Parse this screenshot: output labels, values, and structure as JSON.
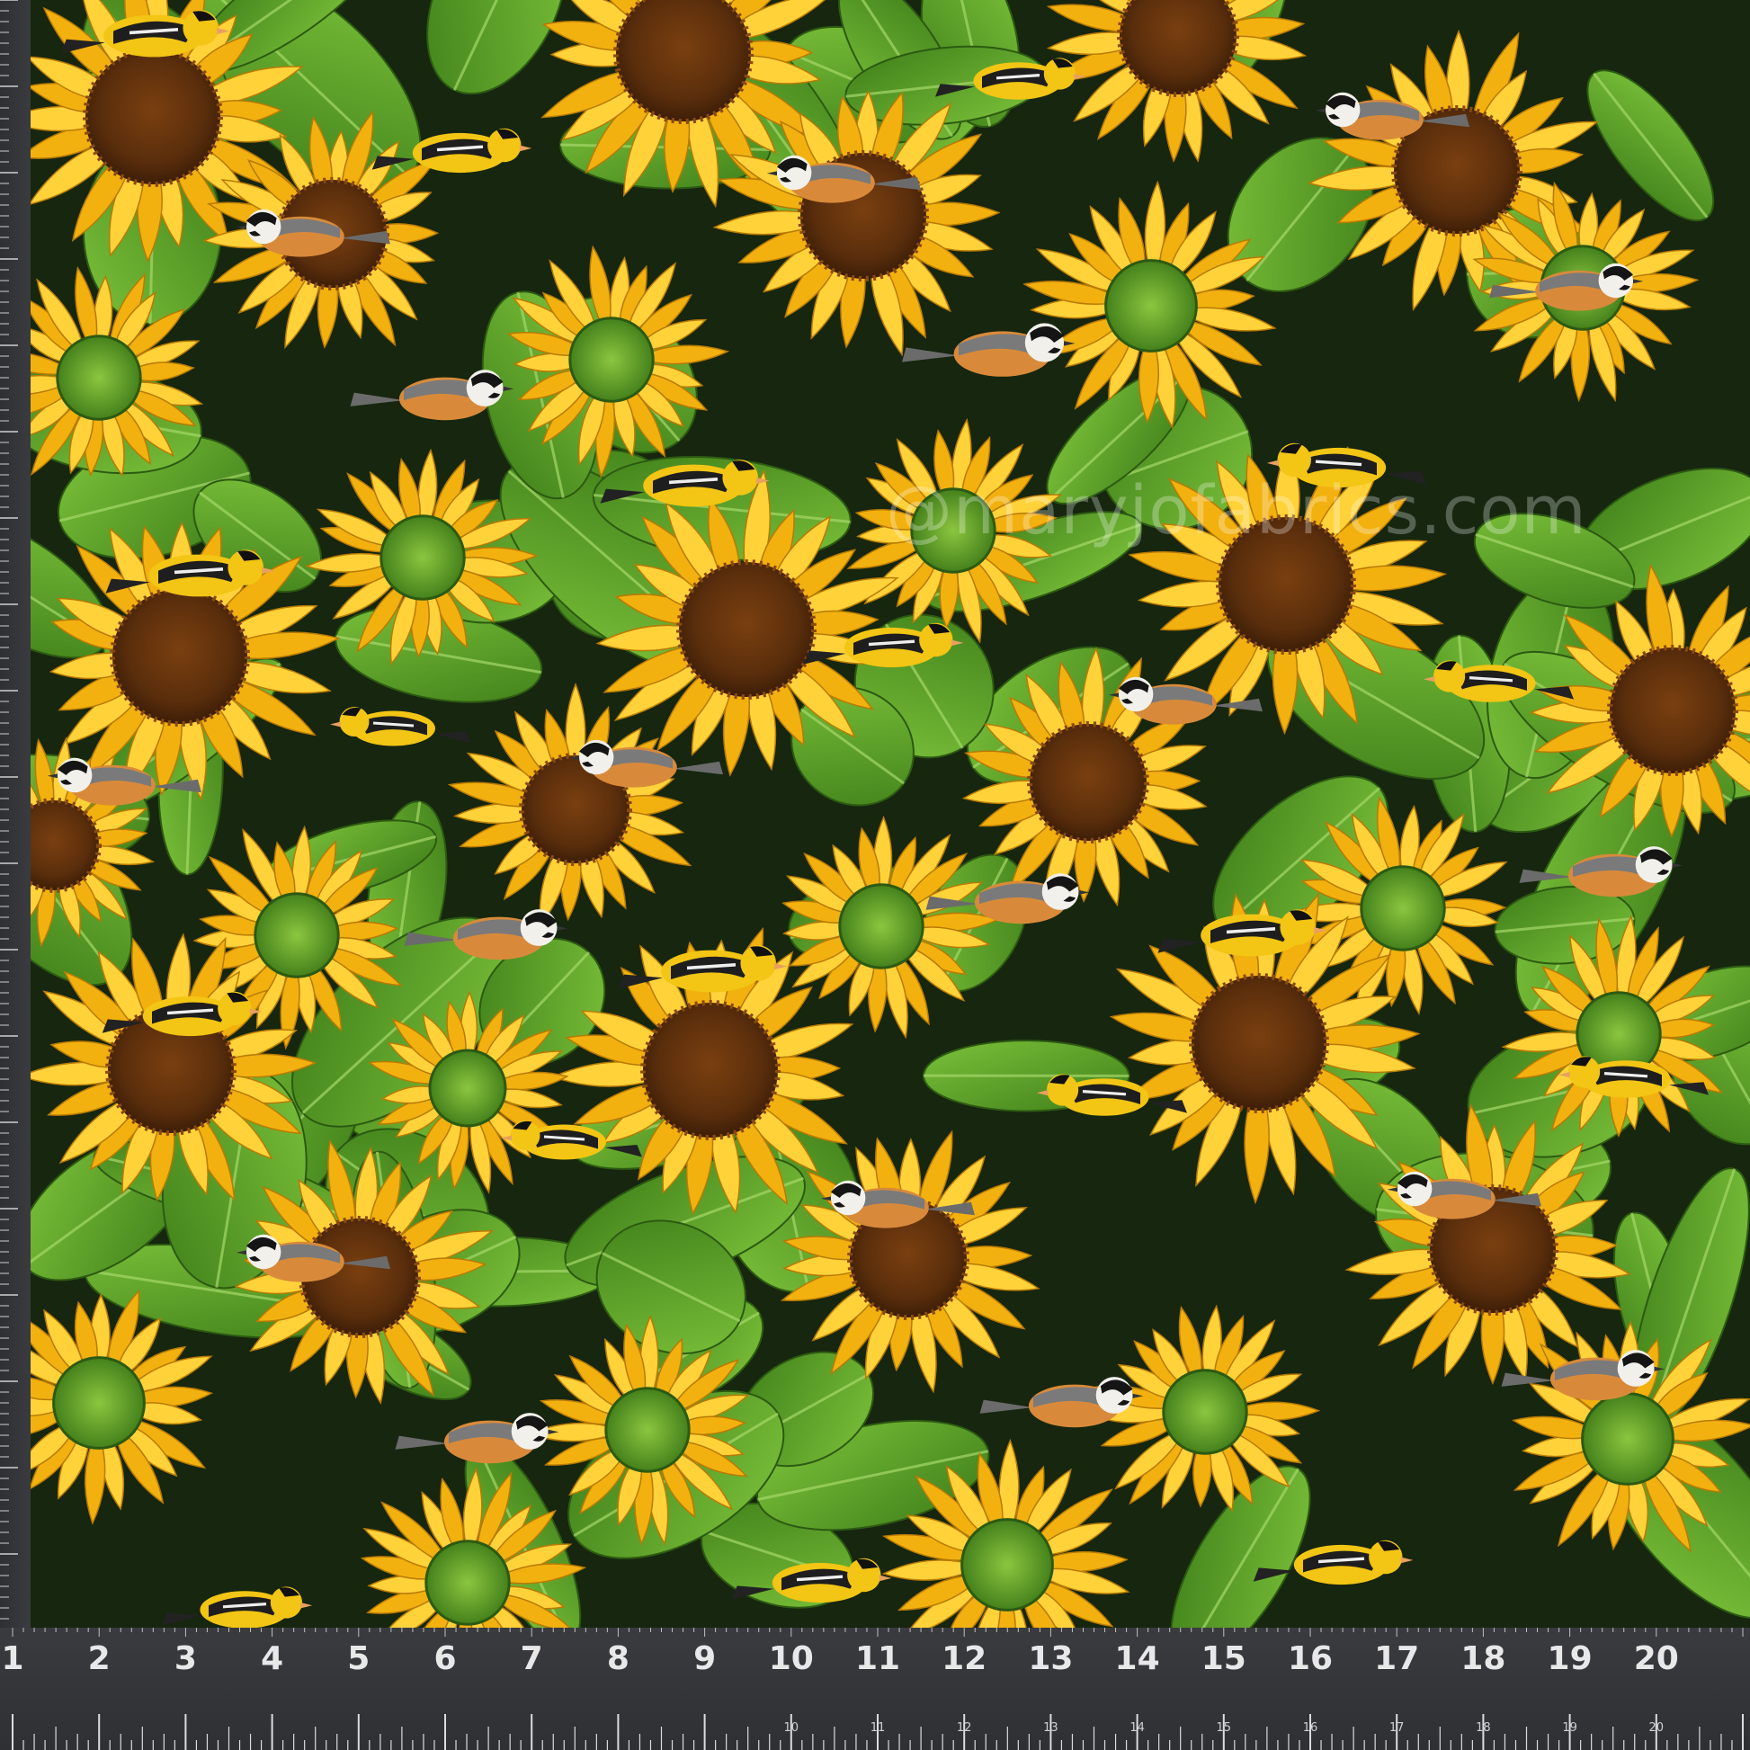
{
  "image": {
    "subject": "sunflower and songbird print cotton fabric on a cutting mat",
    "colors": {
      "background": "#16260f",
      "petal": "#f2b10f",
      "petal_light": "#ffd23a",
      "center": "#5a2e0c",
      "leaf": "#4f9a22",
      "leaf_light": "#7cc23a",
      "goldfinch": "#f3c514",
      "chickadee_breast": "#d88a3a",
      "mat": "#35363a"
    }
  },
  "watermark": {
    "text": "@maryjofabrics.com"
  },
  "ruler": {
    "major_labels": [
      "1",
      "2",
      "3",
      "4",
      "5",
      "6",
      "7",
      "8",
      "9",
      "10",
      "11",
      "12",
      "13",
      "14",
      "15",
      "16",
      "17",
      "18",
      "19",
      "20"
    ],
    "minor_labels": [
      "10",
      "11",
      "12",
      "13",
      "14",
      "15",
      "16",
      "17",
      "18",
      "19",
      "20"
    ]
  }
}
